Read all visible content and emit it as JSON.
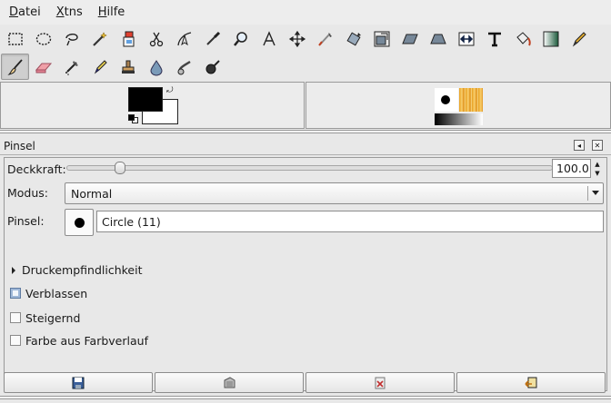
{
  "menubar": {
    "items": [
      {
        "underline": "D",
        "rest": "atei"
      },
      {
        "underline": "X",
        "rest": "tns"
      },
      {
        "underline": "H",
        "rest": "ilfe"
      }
    ]
  },
  "dock": {
    "title": "Pinsel",
    "opacity_label": "Deckkraft:",
    "opacity_value": "100.0",
    "opacity_fraction": 0.11,
    "mode_label": "Modus:",
    "mode_value": "Normal",
    "brush_label": "Pinsel:",
    "brush_value": "Circle (11)",
    "pressure_label": "Druckempfindlichkeit",
    "fade_label": "Verblassen",
    "increment_label": "Steigernd",
    "gradient_label": "Farbe aus Farbverlauf"
  },
  "colors": {
    "foreground": "#000000",
    "background": "#ffffff",
    "accent": "#5e7aa0"
  },
  "icons": {
    "row1": [
      "rect-select-icon",
      "ellipse-select-icon",
      "lasso-icon",
      "fuzzy-select-icon",
      "color-select-icon",
      "scissors-icon",
      "paths-icon",
      "color-picker-icon",
      "magnify-icon",
      "measure-icon",
      "move-icon",
      "crop-icon",
      "rotate-icon",
      "scale-icon",
      "shear-icon",
      "perspective-icon",
      "flip-icon",
      "text-icon",
      "bucket-fill-icon",
      "blend-icon",
      "pencil-icon"
    ],
    "row2": [
      "paintbrush-icon",
      "eraser-icon",
      "airbrush-icon",
      "ink-icon",
      "clone-icon",
      "blur-icon",
      "smudge-icon",
      "dodge-burn-icon"
    ]
  }
}
